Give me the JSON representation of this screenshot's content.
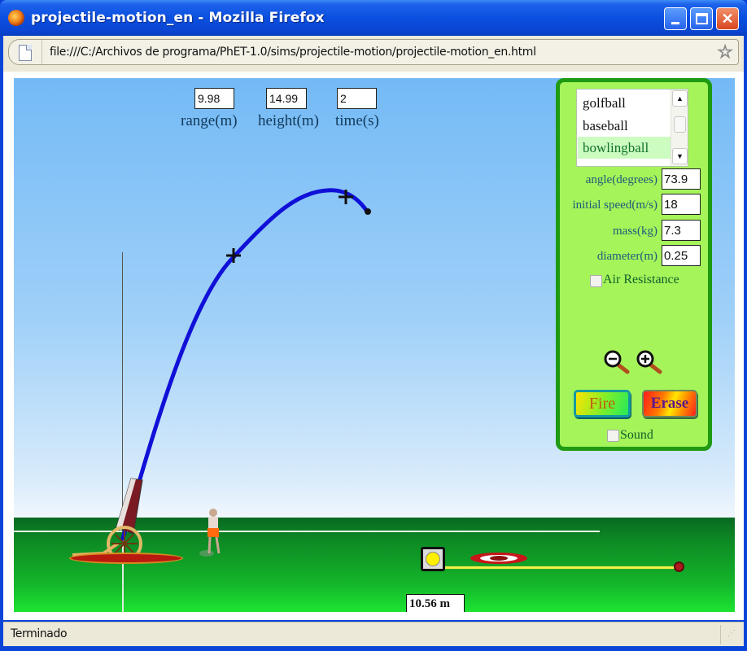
{
  "window": {
    "title": "projectile-motion_en - Mozilla Firefox",
    "controls": [
      "minimize",
      "maximize",
      "close"
    ]
  },
  "navbar": {
    "url": "file:///C:/Archivos de programa/PhET-1.0/sims/projectile-motion/projectile-motion_en.html"
  },
  "readouts": {
    "range": {
      "value": "9.98",
      "label": "range(m)"
    },
    "height": {
      "value": "14.99",
      "label": "height(m)"
    },
    "time": {
      "value": "2",
      "label": "time(s)"
    }
  },
  "panel": {
    "projectiles": [
      {
        "label": "golfball",
        "selected": false
      },
      {
        "label": "baseball",
        "selected": false
      },
      {
        "label": "bowlingball",
        "selected": true
      }
    ],
    "params": {
      "angle": {
        "label": "angle(degrees)",
        "value": "73.9"
      },
      "speed": {
        "label": "initial speed(m/s)",
        "value": "18"
      },
      "mass": {
        "label": "mass(kg)",
        "value": "7.3"
      },
      "diameter": {
        "label": "diameter(m)",
        "value": "0.25"
      }
    },
    "air_resistance": {
      "label": "Air Resistance",
      "checked": false
    },
    "fire_label": "Fire",
    "erase_label": "Erase",
    "sound": {
      "label": "Sound",
      "checked": false
    }
  },
  "scene": {
    "tape_measure_readout": "10.56 m",
    "colors": {
      "trajectory": "#1010d8",
      "panel_bg": "#a5f45a",
      "panel_border": "#1f9a12"
    }
  },
  "statusbar": {
    "text": "Terminado"
  }
}
